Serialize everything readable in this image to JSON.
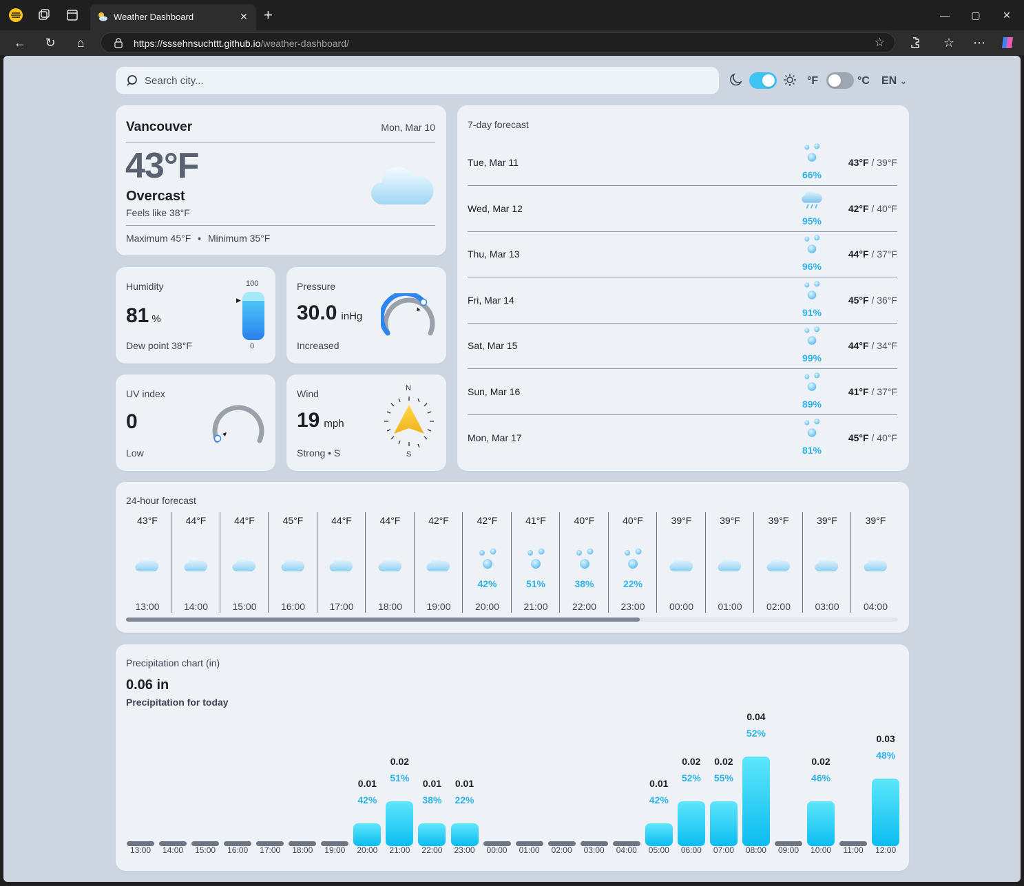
{
  "browser": {
    "tab_title": "Weather Dashboard",
    "url_host": "https://sssehnsuchttt.github.io",
    "url_path": "/weather-dashboard/"
  },
  "header": {
    "search_placeholder": "Search city...",
    "unit_f": "°F",
    "unit_c": "°C",
    "language": "EN",
    "dark_mode_on": true,
    "celsius_on": false
  },
  "current": {
    "city": "Vancouver",
    "date": "Mon, Mar 10",
    "temp": "43°F",
    "condition": "Overcast",
    "feels_like": "Feels like 38°F",
    "max_label": "Maximum 45°F",
    "min_label": "Minimum 35°F"
  },
  "humidity": {
    "title": "Humidity",
    "value": "81",
    "unit": "%",
    "dew": "Dew point 38°F",
    "scale_max": "100",
    "scale_min": "0",
    "level": 0.81
  },
  "pressure": {
    "title": "Pressure",
    "value": "30.0",
    "unit": "inHg",
    "trend": "Increased"
  },
  "uv": {
    "title": "UV index",
    "value": "0",
    "level": "Low"
  },
  "wind": {
    "title": "Wind",
    "value": "19",
    "unit": "mph",
    "desc": "Strong • S",
    "north": "N",
    "south": "S"
  },
  "weekly": {
    "title": "7-day forecast",
    "days": [
      {
        "day": "Tue, Mar 11",
        "pct": "66%",
        "hi": "43°F",
        "lo": "39°F",
        "icon": "drizzle-icon"
      },
      {
        "day": "Wed, Mar 12",
        "pct": "95%",
        "hi": "42°F",
        "lo": "40°F",
        "icon": "rain-cloud-icon"
      },
      {
        "day": "Thu, Mar 13",
        "pct": "96%",
        "hi": "44°F",
        "lo": "37°F",
        "icon": "drizzle-icon"
      },
      {
        "day": "Fri, Mar 14",
        "pct": "91%",
        "hi": "45°F",
        "lo": "36°F",
        "icon": "drizzle-icon"
      },
      {
        "day": "Sat, Mar 15",
        "pct": "99%",
        "hi": "44°F",
        "lo": "34°F",
        "icon": "drizzle-icon"
      },
      {
        "day": "Sun, Mar 16",
        "pct": "89%",
        "hi": "41°F",
        "lo": "37°F",
        "icon": "drizzle-icon"
      },
      {
        "day": "Mon, Mar 17",
        "pct": "81%",
        "hi": "45°F",
        "lo": "40°F",
        "icon": "drizzle-icon"
      }
    ]
  },
  "hourly": {
    "title": "24-hour forecast",
    "items": [
      {
        "temp": "43°F",
        "pct": "",
        "hour": "13:00",
        "icon": "cloud-icon"
      },
      {
        "temp": "44°F",
        "pct": "",
        "hour": "14:00",
        "icon": "cloud-icon"
      },
      {
        "temp": "44°F",
        "pct": "",
        "hour": "15:00",
        "icon": "cloud-icon"
      },
      {
        "temp": "45°F",
        "pct": "",
        "hour": "16:00",
        "icon": "cloud-icon"
      },
      {
        "temp": "44°F",
        "pct": "",
        "hour": "17:00",
        "icon": "cloud-icon"
      },
      {
        "temp": "44°F",
        "pct": "",
        "hour": "18:00",
        "icon": "cloud-icon"
      },
      {
        "temp": "42°F",
        "pct": "",
        "hour": "19:00",
        "icon": "cloud-icon"
      },
      {
        "temp": "42°F",
        "pct": "42%",
        "hour": "20:00",
        "icon": "drizzle-icon"
      },
      {
        "temp": "41°F",
        "pct": "51%",
        "hour": "21:00",
        "icon": "drizzle-icon"
      },
      {
        "temp": "40°F",
        "pct": "38%",
        "hour": "22:00",
        "icon": "drizzle-icon"
      },
      {
        "temp": "40°F",
        "pct": "22%",
        "hour": "23:00",
        "icon": "drizzle-icon"
      },
      {
        "temp": "39°F",
        "pct": "",
        "hour": "00:00",
        "icon": "cloud-icon"
      },
      {
        "temp": "39°F",
        "pct": "",
        "hour": "01:00",
        "icon": "cloud-icon"
      },
      {
        "temp": "39°F",
        "pct": "",
        "hour": "02:00",
        "icon": "cloud-icon"
      },
      {
        "temp": "39°F",
        "pct": "",
        "hour": "03:00",
        "icon": "cloud-icon"
      },
      {
        "temp": "39°F",
        "pct": "",
        "hour": "04:00",
        "icon": "cloud-icon"
      }
    ]
  },
  "precip": {
    "title": "Precipitation chart (in)",
    "total": "0.06 in",
    "subtitle": "Precipitation for today"
  },
  "chart_data": {
    "type": "bar",
    "title": "Precipitation chart (in)",
    "categories": [
      "13:00",
      "14:00",
      "15:00",
      "16:00",
      "17:00",
      "18:00",
      "19:00",
      "20:00",
      "21:00",
      "22:00",
      "23:00",
      "00:00",
      "01:00",
      "02:00",
      "03:00",
      "04:00",
      "05:00",
      "06:00",
      "07:00",
      "08:00",
      "09:00",
      "10:00",
      "11:00",
      "12:00"
    ],
    "series": [
      {
        "values": [
          0,
          0,
          0,
          0,
          0,
          0,
          0,
          0.01,
          0.02,
          0.01,
          0.01,
          0,
          0,
          0,
          0,
          0,
          0.01,
          0.02,
          0.02,
          0.04,
          0,
          0.02,
          0,
          0.03
        ]
      }
    ],
    "value_labels": [
      "",
      "",
      "",
      "",
      "",
      "",
      "",
      "0.01",
      "0.02",
      "0.01",
      "0.01",
      "",
      "",
      "",
      "",
      "",
      "0.01",
      "0.02",
      "0.02",
      "0.04",
      "",
      "0.02",
      "",
      "0.03"
    ],
    "probability_labels": [
      "",
      "",
      "",
      "",
      "",
      "",
      "",
      "42%",
      "51%",
      "38%",
      "22%",
      "",
      "",
      "",
      "",
      "",
      "42%",
      "52%",
      "55%",
      "52%",
      "",
      "46%",
      "",
      "48%"
    ],
    "ylim": [
      0,
      0.04
    ]
  }
}
